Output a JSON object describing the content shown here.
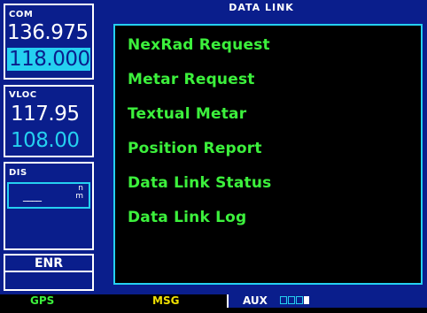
{
  "left": {
    "com": {
      "label": "COM",
      "active": "136.975",
      "standby": "118.000"
    },
    "vloc": {
      "label": "VLOC",
      "active": "117.95",
      "standby": "108.00"
    },
    "dis": {
      "label": "DIS",
      "unit_top": "n",
      "unit_bottom": "m",
      "value": "____"
    },
    "mode": "ENR"
  },
  "main": {
    "title": "DATA LINK",
    "items": [
      "NexRad Request",
      "Metar Request",
      "Textual Metar",
      "Position Report",
      "Data Link Status",
      "Data Link Log"
    ]
  },
  "bottom": {
    "gps": "GPS",
    "msg": "MSG",
    "aux": "AUX"
  },
  "colors": {
    "background": "#0a1e8c",
    "accent_cyan": "#25d0f0",
    "menu_green": "#3cf03c",
    "msg_yellow": "#f0e000"
  }
}
